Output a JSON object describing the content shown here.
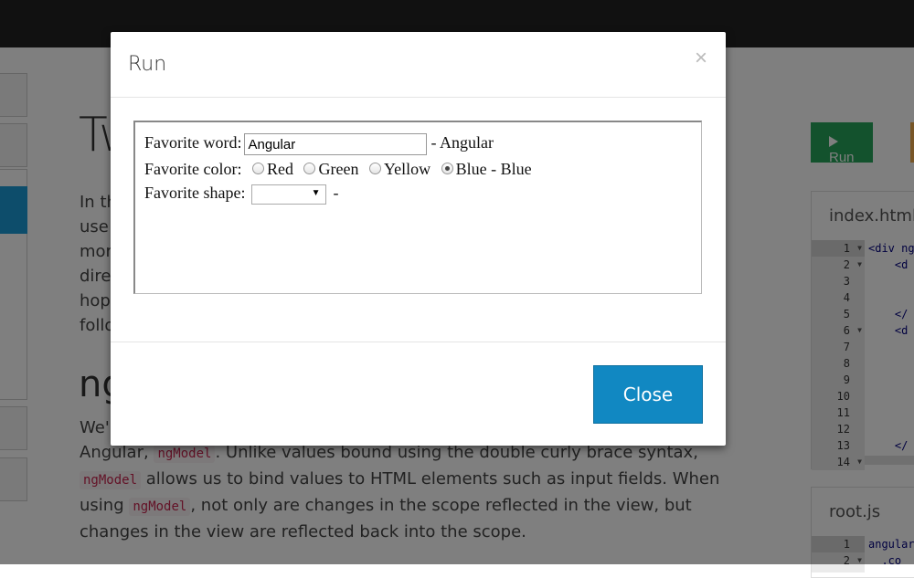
{
  "background": {
    "title": "Tw",
    "paragraph_lines": [
      "In th",
      "use",
      "mor",
      "dire",
      "hop",
      "follo"
    ],
    "section_title": "ng",
    "paragraph2": {
      "line1": "We'",
      "line2_pre": "Angular, ",
      "line2_code": "ngModel",
      "line2_post": ". Unlike values bound using the double curly brace syntax,",
      "line3_code": "ngModel",
      "line3_post": " allows us to bind values to HTML elements such as input fields. When",
      "line4_pre": "using ",
      "line4_code": "ngModel",
      "line4_post": ", not only are changes in the scope reflected in the view, but",
      "line5": "changes in the view are reflected back into the scope."
    },
    "run_button": "Run",
    "files": [
      {
        "name": "index.html",
        "line_numbers": [
          "1",
          "2",
          "3",
          "4",
          "5",
          "6",
          "7",
          "8",
          "9",
          "10",
          "11",
          "12",
          "13",
          "14"
        ],
        "code": [
          "<div ng",
          "    <d",
          "",
          "",
          "    </",
          "    <d",
          "",
          "",
          "",
          "",
          "",
          "",
          "    </",
          ""
        ]
      },
      {
        "name": "root.js",
        "line_numbers": [
          "1",
          "2"
        ],
        "code": [
          "angular",
          "  .co"
        ]
      }
    ]
  },
  "modal": {
    "title": "Run",
    "close_symbol": "×",
    "form": {
      "word_label": "Favorite word:",
      "word_value": "Angular",
      "word_echo": "- Angular",
      "color_label": "Favorite color:",
      "color_options": [
        "Red",
        "Green",
        "Yellow",
        "Blue"
      ],
      "color_selected": "Blue",
      "color_echo": "- Blue",
      "shape_label": "Favorite shape:",
      "shape_value": "",
      "shape_echo": "-"
    },
    "close_button": "Close"
  }
}
